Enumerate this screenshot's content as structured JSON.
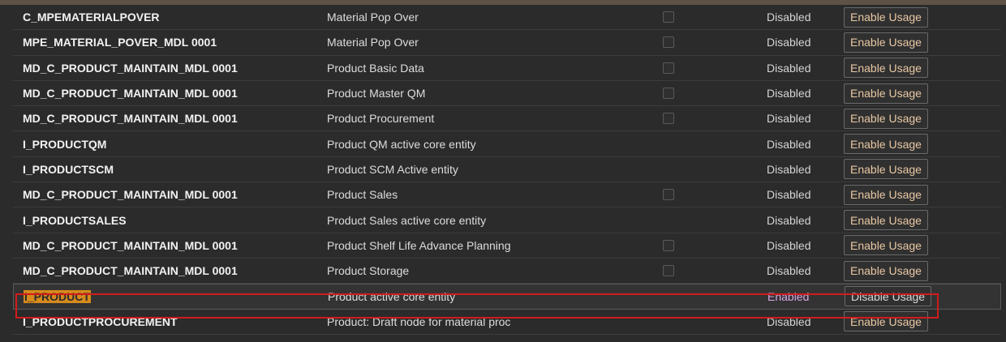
{
  "rows": [
    {
      "id": "C_MPEMATERIALPOVER",
      "description": "Material Pop Over",
      "has_checkbox": true,
      "status": "Disabled",
      "action": "Enable Usage",
      "selected": false
    },
    {
      "id": "MPE_MATERIAL_POVER_MDL 0001",
      "description": "Material Pop Over",
      "has_checkbox": true,
      "status": "Disabled",
      "action": "Enable Usage",
      "selected": false
    },
    {
      "id": "MD_C_PRODUCT_MAINTAIN_MDL 0001",
      "description": "Product Basic Data",
      "has_checkbox": true,
      "status": "Disabled",
      "action": "Enable Usage",
      "selected": false
    },
    {
      "id": "MD_C_PRODUCT_MAINTAIN_MDL 0001",
      "description": "Product Master QM",
      "has_checkbox": true,
      "status": "Disabled",
      "action": "Enable Usage",
      "selected": false
    },
    {
      "id": "MD_C_PRODUCT_MAINTAIN_MDL 0001",
      "description": "Product Procurement",
      "has_checkbox": true,
      "status": "Disabled",
      "action": "Enable Usage",
      "selected": false
    },
    {
      "id": "I_PRODUCTQM",
      "description": "Product QM active core entity",
      "has_checkbox": false,
      "status": "Disabled",
      "action": "Enable Usage",
      "selected": false
    },
    {
      "id": "I_PRODUCTSCM",
      "description": "Product SCM Active entity",
      "has_checkbox": false,
      "status": "Disabled",
      "action": "Enable Usage",
      "selected": false
    },
    {
      "id": "MD_C_PRODUCT_MAINTAIN_MDL 0001",
      "description": "Product Sales",
      "has_checkbox": true,
      "status": "Disabled",
      "action": "Enable Usage",
      "selected": false
    },
    {
      "id": "I_PRODUCTSALES",
      "description": "Product Sales active core entity",
      "has_checkbox": false,
      "status": "Disabled",
      "action": "Enable Usage",
      "selected": false
    },
    {
      "id": "MD_C_PRODUCT_MAINTAIN_MDL 0001",
      "description": "Product Shelf Life Advance Planning",
      "has_checkbox": true,
      "status": "Disabled",
      "action": "Enable Usage",
      "selected": false
    },
    {
      "id": "MD_C_PRODUCT_MAINTAIN_MDL 0001",
      "description": "Product Storage",
      "has_checkbox": true,
      "status": "Disabled",
      "action": "Enable Usage",
      "selected": false
    },
    {
      "id": "I_PRODUCT",
      "description": "Product active core entity",
      "has_checkbox": false,
      "status": "Enabled",
      "action": "Disable Usage",
      "selected": true
    },
    {
      "id": "I_PRODUCTPROCUREMENT",
      "description": "Product: Draft node for material proc",
      "has_checkbox": false,
      "status": "Disabled",
      "action": "Enable Usage",
      "selected": false
    }
  ],
  "colors": {
    "background": "#2b2b2b",
    "enabled_status": "#d8a6e6",
    "enable_button_text": "#e8c8a4",
    "highlight": "#d68a1c",
    "selection_outline": "#d21b1b"
  }
}
